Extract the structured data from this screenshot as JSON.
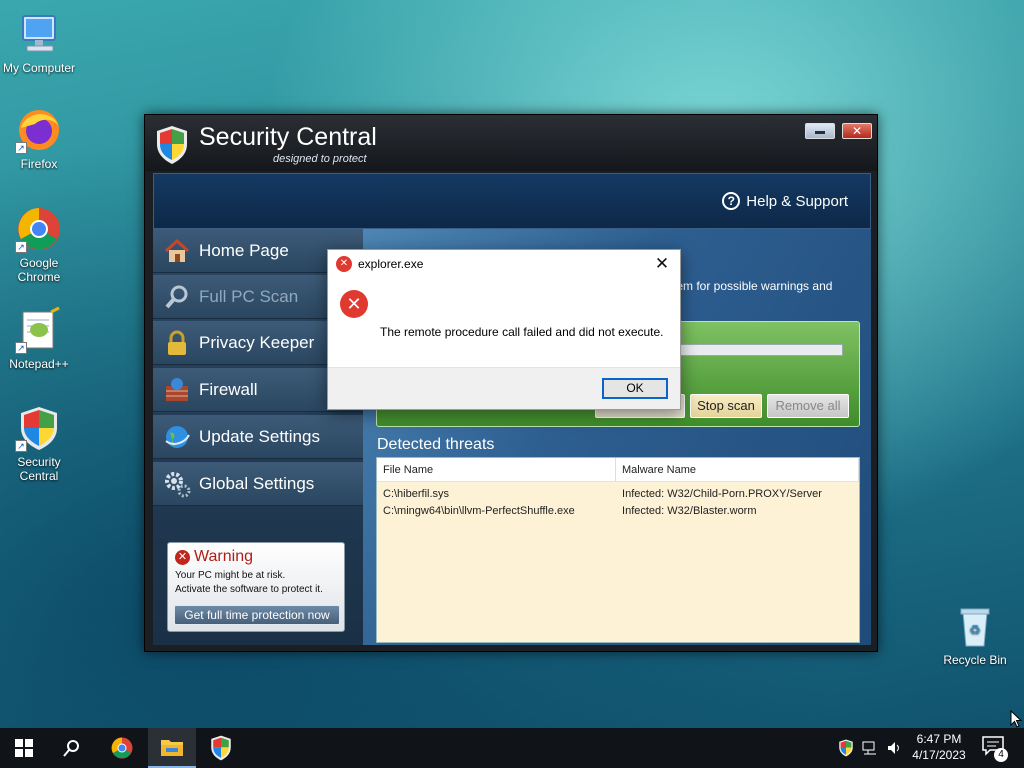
{
  "desktop": {
    "icons": [
      {
        "label": "My Computer"
      },
      {
        "label": "Firefox"
      },
      {
        "label": "Google Chrome"
      },
      {
        "label": "Notepad++"
      },
      {
        "label": "Security Central"
      },
      {
        "label": "Recycle Bin"
      }
    ]
  },
  "app": {
    "title": "Security Central",
    "subtitle": "designed to protect",
    "help_label": "Help & Support",
    "nav": [
      {
        "label": "Home Page",
        "icon": "house-icon"
      },
      {
        "label": "Full PC Scan",
        "icon": "magnifier-icon"
      },
      {
        "label": "Privacy Keeper",
        "icon": "padlock-icon"
      },
      {
        "label": "Firewall",
        "icon": "firewall-icon"
      },
      {
        "label": "Update Settings",
        "icon": "globe-icon"
      },
      {
        "label": "Global Settings",
        "icon": "gears-icon"
      }
    ],
    "warning": {
      "title": "Warning",
      "line1": "Your PC might be at risk.",
      "line2": "Activate the software to protect it.",
      "button": "Get full time protection now"
    },
    "scan": {
      "description": "tem for possible warnings and",
      "stop_label": "Stop scan",
      "remove_label": "Remove all"
    },
    "threats": {
      "title": "Detected threats",
      "columns": [
        "File Name",
        "Malware Name"
      ],
      "rows": [
        {
          "file": "C:\\hiberfil.sys",
          "malware": "Infected: W32/Child-Porn.PROXY/Server"
        },
        {
          "file": "C:\\mingw64\\bin\\llvm-PerfectShuffle.exe",
          "malware": "Infected: W32/Blaster.worm"
        }
      ]
    }
  },
  "dialog": {
    "title": "explorer.exe",
    "message": "The remote procedure call failed and did not execute.",
    "ok_label": "OK"
  },
  "taskbar": {
    "time": "6:47 PM",
    "date": "4/17/2023",
    "notification_count": "4"
  }
}
